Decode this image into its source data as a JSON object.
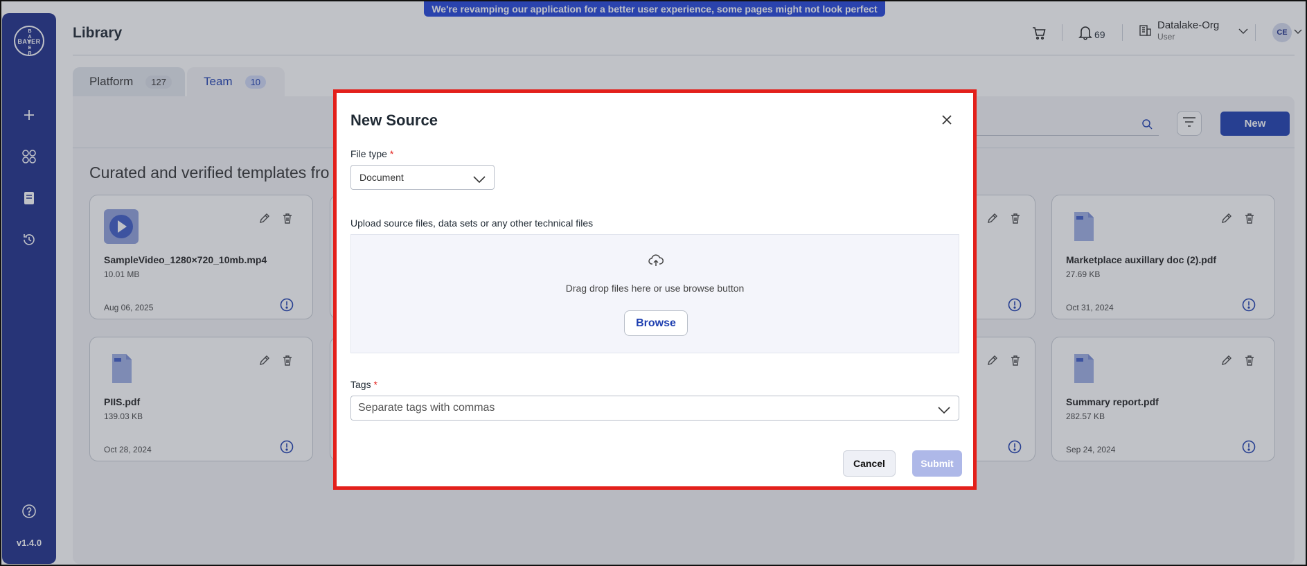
{
  "banner": {
    "text": "We're revamping our application for a better user experience, some pages might not look perfect yet!"
  },
  "sidebar": {
    "logo": {
      "horizontal": "BAYER",
      "vertical": "BAYER"
    },
    "version": "v1.4.0",
    "items": [
      {
        "icon": "plus-icon"
      },
      {
        "icon": "apps-grid-icon"
      },
      {
        "icon": "book-icon"
      },
      {
        "icon": "history-icon"
      },
      {
        "icon": "help-icon"
      }
    ]
  },
  "header": {
    "title": "Library",
    "notifications_count": "69",
    "org_name": "Datalake-Org",
    "org_role": "User",
    "avatar_initials": "CE"
  },
  "tabs": [
    {
      "label": "Platform",
      "count": "127"
    },
    {
      "label": "Team",
      "count": "10",
      "active": true
    }
  ],
  "toolbar": {
    "new_label": "New"
  },
  "section_heading": "Curated and verified templates fro",
  "cards": [
    {
      "name": "SampleVideo_1280×720_10mb.mp4",
      "size": "10.01 MB",
      "date": "Aug 06, 2025",
      "type": "video"
    },
    {
      "name": "Marketplace auxillary doc (2).pdf",
      "size": "27.69 KB",
      "date": "Oct 31, 2024",
      "type": "pdf"
    },
    {
      "name": "PIIS.pdf",
      "size": "139.03 KB",
      "date": "Oct 28, 2024",
      "type": "pdf"
    },
    {
      "name": "Summary report.pdf",
      "size": "282.57 KB",
      "date": "Sep 24, 2024",
      "type": "pdf"
    }
  ],
  "modal": {
    "title": "New Source",
    "file_type_label": "File type",
    "required_mark": "*",
    "file_type_value": "Document",
    "upload_label": "Upload source files, data sets or any other technical files",
    "dropzone_text": "Drag drop files here or use browse button",
    "browse_label": "Browse",
    "tags_label": "Tags",
    "tags_placeholder": "Separate tags with commas",
    "cancel_label": "Cancel",
    "submit_label": "Submit"
  },
  "colors": {
    "sidebar": "#1e2f8a",
    "accent": "#1e3fb0",
    "banner": "#2344d9",
    "highlight_border": "#e3201b",
    "submit_disabled": "#aeb8e8"
  }
}
